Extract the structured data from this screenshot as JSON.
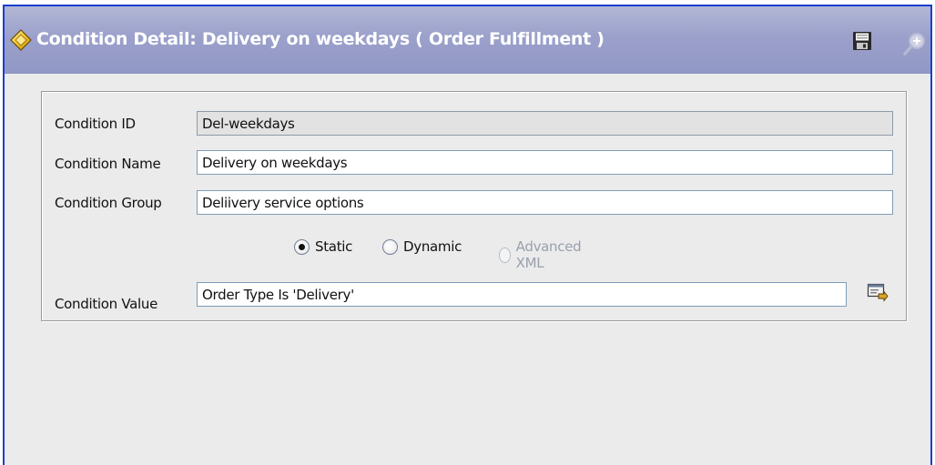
{
  "header": {
    "title": "Condition Detail: Delivery on weekdays ( Order Fulfillment )",
    "icons": {
      "title": "diamond-condition-icon",
      "save": "save-icon",
      "zoom": "zoom-lookup-icon"
    }
  },
  "form": {
    "condition_id": {
      "label": "Condition ID",
      "value": "Del-weekdays",
      "readonly": true
    },
    "condition_name": {
      "label": "Condition Name",
      "value": "Delivery on weekdays"
    },
    "condition_group": {
      "label": "Condition Group",
      "value": "Deliivery service options"
    },
    "type_options": {
      "static": {
        "label": "Static",
        "selected": true
      },
      "dynamic": {
        "label": "Dynamic",
        "selected": false
      },
      "advanced_xml": {
        "label": "Advanced XML",
        "selected": false,
        "disabled": true
      }
    },
    "condition_value": {
      "label": "Condition Value",
      "value": "Order Type Is 'Delivery'",
      "builder_icon": "condition-builder-icon"
    }
  },
  "colors": {
    "window_border": "#1a3fd0",
    "titlebar": "#9ba1cb",
    "title_text": "#ffffff",
    "body_bg": "#ebebeb",
    "field_border": "#7f9db9",
    "readonly_bg": "#e2e2e2",
    "disabled_text": "#9aa0ad"
  }
}
